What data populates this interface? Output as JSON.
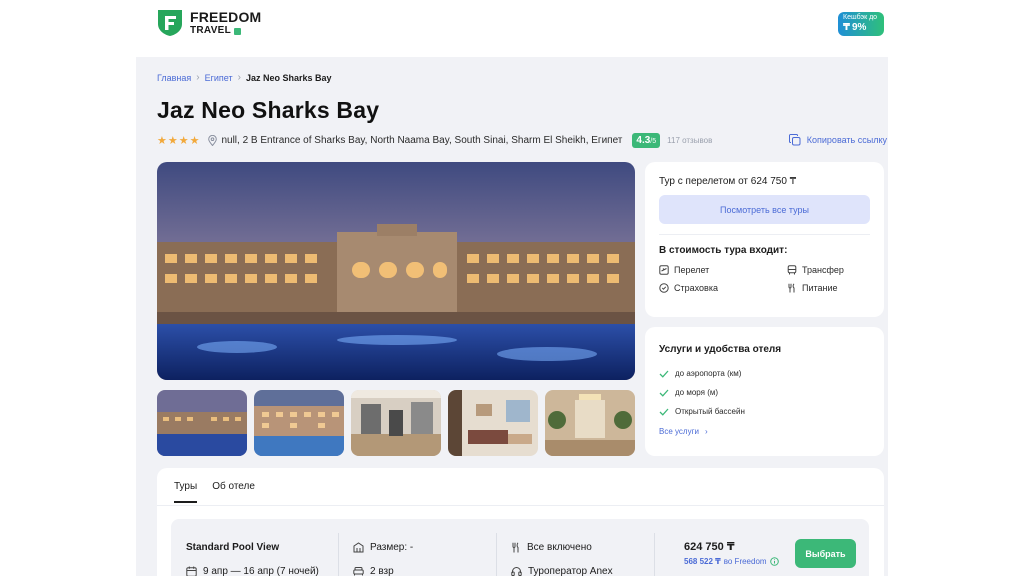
{
  "brand": {
    "line1": "FREEDOM",
    "line2": "TRAVEL"
  },
  "cashback": {
    "label": "Кешбэк до",
    "value": "9%"
  },
  "breadcrumb": [
    "Главная",
    "Египет",
    "Jaz Neo Sharks Bay"
  ],
  "hotel": {
    "name": "Jaz Neo Sharks Bay",
    "stars": 4,
    "stars_text": "★★★★",
    "address": "null, 2 B Entrance of Sharks Bay, North Naama Bay, South Sinai, Sharm El Sheikh, Египет",
    "rating": "4.3",
    "rating_scale": "/5",
    "reviews": "117 отзывов",
    "copy_link": "Копировать ссылку"
  },
  "price_card": {
    "from_text": "Тур с перелетом от 624 750 ₸",
    "button": "Посмотреть все туры",
    "includes_title": "В стоимость тура входит:",
    "includes": [
      {
        "label": "Перелет",
        "icon": "flight-icon"
      },
      {
        "label": "Трансфер",
        "icon": "bus-icon"
      },
      {
        "label": "Страховка",
        "icon": "shield-icon"
      },
      {
        "label": "Питание",
        "icon": "cutlery-icon"
      }
    ]
  },
  "amenities": {
    "title": "Услуги и удобства отеля",
    "items": [
      "до аэропорта (км)",
      "до моря (м)",
      "Открытый бассейн"
    ],
    "all_link": "Все услуги"
  },
  "tabs": [
    "Туры",
    "Об отеле"
  ],
  "offer": {
    "room": "Standard Pool View",
    "dates": "9 апр — 16 апр (7 ночей)",
    "size": "Размер: -",
    "guests": "2 взр",
    "meal": "Все включено",
    "operator": "Туроператор Anex",
    "price": "624 750 ₸",
    "cashback_price": "568 522 ₸",
    "cashback_with": "во Freedom",
    "select_button": "Выбрать"
  },
  "colors": {
    "accent": "#4b6bd6",
    "green": "#3cb878",
    "star": "#f2a93b",
    "page_bg": "#f1f2f6"
  }
}
